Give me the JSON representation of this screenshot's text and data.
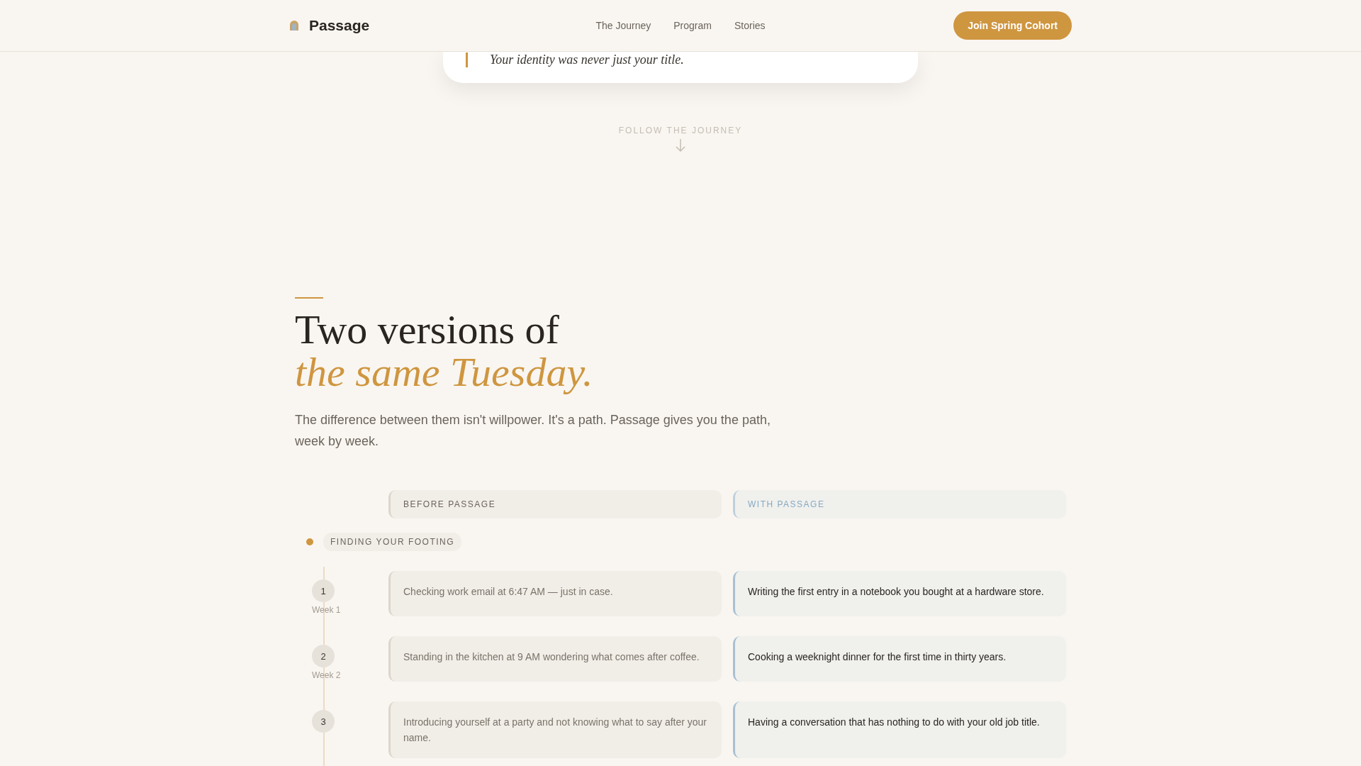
{
  "header": {
    "brand": "Passage",
    "nav": [
      "The Journey",
      "Program",
      "Stories"
    ],
    "cta": "Join Spring Cohort"
  },
  "quote_card": {
    "quote": "Your identity was never just your title."
  },
  "scroll_hint": {
    "label": "FOLLOW THE JOURNEY"
  },
  "section": {
    "title": "Two versions of",
    "title_accent": "the same Tuesday.",
    "intro": "The difference between them isn't willpower. It's a path. Passage gives you the path, week by week."
  },
  "comparison": {
    "columns": [
      {
        "label": "BEFORE PASSAGE",
        "kind": "before"
      },
      {
        "label": "WITH PASSAGE",
        "kind": "with"
      }
    ],
    "phase": {
      "label": "FINDING YOUR FOOTING"
    },
    "rows": [
      {
        "number": "1",
        "week": "Week 1",
        "before": "Checking work email at 6:47 AM — just in case.",
        "with": "Writing the first entry in a notebook you bought at a hardware store."
      },
      {
        "number": "2",
        "week": "Week 2",
        "before": "Standing in the kitchen at 9 AM wondering what comes after coffee.",
        "with": "Cooking a weeknight dinner for the first time in thirty years."
      },
      {
        "number": "3",
        "before": "Introducing yourself at a party and not knowing what to say after your name.",
        "with": "Having a conversation that has nothing to do with your old job title."
      }
    ]
  }
}
